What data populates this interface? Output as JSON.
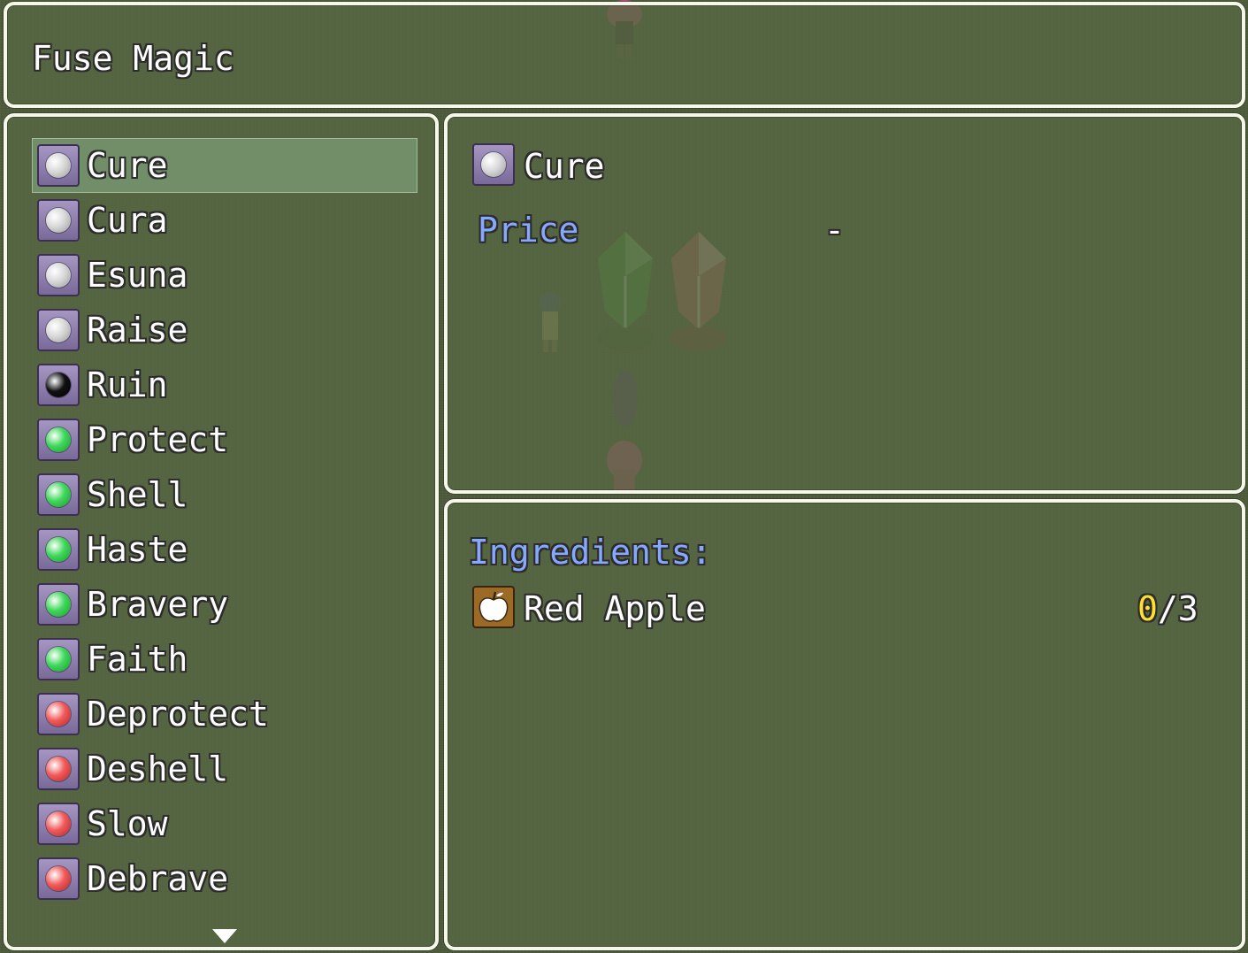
{
  "help": {
    "title": "Fuse Magic"
  },
  "magic_list": {
    "items": [
      {
        "label": "Cure",
        "icon": "white-orb-icon",
        "color": "#d8d8d8",
        "dark": "#9a9a9a",
        "selected": true
      },
      {
        "label": "Cura",
        "icon": "white-orb-icon",
        "color": "#d8d8d8",
        "dark": "#9a9a9a"
      },
      {
        "label": "Esuna",
        "icon": "white-orb-icon",
        "color": "#d8d8d8",
        "dark": "#9a9a9a"
      },
      {
        "label": "Raise",
        "icon": "white-orb-icon",
        "color": "#d8d8d8",
        "dark": "#9a9a9a"
      },
      {
        "label": "Ruin",
        "icon": "black-orb-icon",
        "color": "#111111",
        "dark": "#000000"
      },
      {
        "label": "Protect",
        "icon": "green-orb-icon",
        "color": "#3ed85a",
        "dark": "#1c9a30"
      },
      {
        "label": "Shell",
        "icon": "green-orb-icon",
        "color": "#3ed85a",
        "dark": "#1c9a30"
      },
      {
        "label": "Haste",
        "icon": "green-orb-icon",
        "color": "#3ed85a",
        "dark": "#1c9a30"
      },
      {
        "label": "Bravery",
        "icon": "green-orb-icon",
        "color": "#3ed85a",
        "dark": "#1c9a30"
      },
      {
        "label": "Faith",
        "icon": "green-orb-icon",
        "color": "#3ed85a",
        "dark": "#1c9a30"
      },
      {
        "label": "Deprotect",
        "icon": "red-orb-icon",
        "color": "#f25a5a",
        "dark": "#b02828"
      },
      {
        "label": "Deshell",
        "icon": "red-orb-icon",
        "color": "#f25a5a",
        "dark": "#b02828"
      },
      {
        "label": "Slow",
        "icon": "red-orb-icon",
        "color": "#f25a5a",
        "dark": "#b02828"
      },
      {
        "label": "Debrave",
        "icon": "red-orb-icon",
        "color": "#f25a5a",
        "dark": "#b02828"
      }
    ]
  },
  "status": {
    "item_name": "Cure",
    "item_icon": "white-orb-icon",
    "price_label": "Price",
    "price_value": "-"
  },
  "ingredients": {
    "heading": "Ingredients:",
    "items": [
      {
        "name": "Red Apple",
        "icon": "red-apple-icon",
        "owned": "0",
        "required": "/3"
      }
    ]
  },
  "colors": {
    "system_text": "#86a8ff",
    "owned_count": "#ffe030",
    "window_border": "#f5f7ea"
  }
}
